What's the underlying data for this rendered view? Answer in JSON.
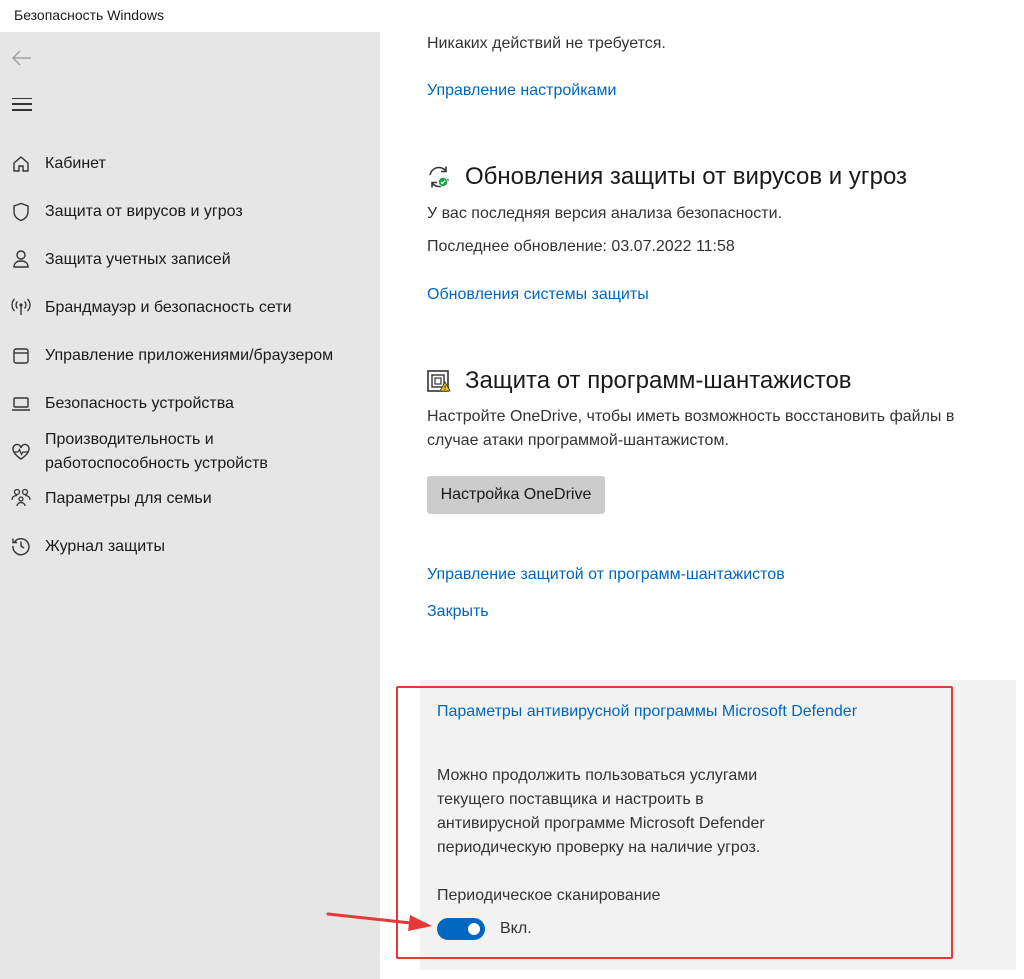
{
  "window": {
    "title": "Безопасность Windows"
  },
  "sidebar": {
    "back_icon": "back-arrow-icon",
    "menu_icon": "hamburger-icon",
    "items": [
      {
        "label": "Кабинет",
        "icon": "home-icon"
      },
      {
        "label": "Защита от вирусов и угроз",
        "icon": "shield-icon"
      },
      {
        "label": "Защита учетных записей",
        "icon": "person-icon"
      },
      {
        "label": "Брандмауэр и безопасность сети",
        "icon": "wifi-antenna-icon"
      },
      {
        "label": "Управление приложениями/браузером",
        "icon": "app-window-icon"
      },
      {
        "label": "Безопасность устройства",
        "icon": "laptop-icon"
      },
      {
        "label_line1": "Производительность и",
        "label_line2": "работоспособность устройств",
        "icon": "heart-pulse-icon"
      },
      {
        "label": "Параметры для семьи",
        "icon": "family-icon"
      },
      {
        "label": "Журнал защиты",
        "icon": "history-icon"
      }
    ]
  },
  "main": {
    "status_text": "Никаких действий не требуется.",
    "manage_settings_link": "Управление настройками",
    "updates": {
      "heading": "Обновления защиты от вирусов и угроз",
      "icon": "update-sync-icon",
      "line1": "У вас последняя версия анализа безопасности.",
      "line2": "Последнее обновление: 03.07.2022 11:58",
      "link": "Обновления системы защиты"
    },
    "ransomware": {
      "heading": "Защита от программ-шантажистов",
      "icon": "ransomware-folder-icon",
      "desc_line1": "Настройте OneDrive, чтобы иметь возможность восстановить файлы в",
      "desc_line2": "случае атаки программой-шантажистом.",
      "button": "Настройка OneDrive",
      "manage_link": "Управление защитой от программ-шантажистов",
      "close_link": "Закрыть"
    },
    "defender": {
      "title_link": "Параметры антивирусной программы Microsoft Defender",
      "desc_line1": "Можно продолжить пользоваться услугами",
      "desc_line2": "текущего поставщика и настроить в",
      "desc_line3": "антивирусной программе Microsoft Defender",
      "desc_line4": "периодическую проверку на наличие угроз.",
      "periodic_label": "Периодическое сканирование",
      "toggle_state": "Вкл.",
      "toggle_on": true
    }
  },
  "colors": {
    "accent": "#0067c0",
    "highlight_outline": "#e53935",
    "sidebar_bg": "#e6e6e6"
  }
}
